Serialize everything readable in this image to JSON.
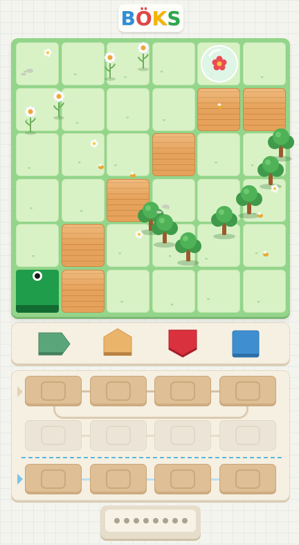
{
  "app": {
    "logo_letters": [
      "B",
      "Ö",
      "K",
      "S"
    ],
    "logo_colors": [
      "#2e8fd6",
      "#e04545",
      "#f4b400",
      "#2aa84a"
    ]
  },
  "board": {
    "rows": 6,
    "cols": 6,
    "wood_tiles": [
      [
        1,
        4
      ],
      [
        1,
        5
      ],
      [
        2,
        3
      ],
      [
        3,
        2
      ],
      [
        4,
        1
      ],
      [
        5,
        1
      ]
    ],
    "player_cell": [
      5,
      0
    ],
    "goal_cell": [
      0,
      4
    ],
    "colors": {
      "grass": "#d8f2c6",
      "board": "#93d58a",
      "wood": "#e6a25a",
      "player": "#1f9d4a"
    }
  },
  "palette": {
    "shapes": [
      {
        "name": "arrow-right",
        "color": "#5aa57a"
      },
      {
        "name": "house",
        "color": "#eab46a"
      },
      {
        "name": "shield",
        "color": "#d9313d"
      },
      {
        "name": "square",
        "color": "#3f8fd0"
      }
    ]
  },
  "program": {
    "rows": 3,
    "slots_per_row": 4,
    "active_rows": [
      0,
      2
    ],
    "loop_color": "#5bb6df"
  },
  "footer": {
    "dot_count": 8
  }
}
